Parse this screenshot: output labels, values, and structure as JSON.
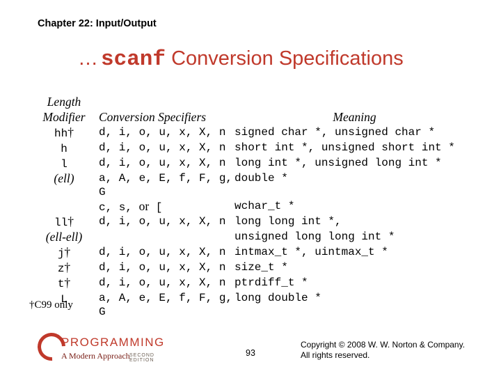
{
  "chapter": "Chapter 22: Input/Output",
  "title": {
    "prefix": "…",
    "code": "scanf",
    "rest": " Conversion Specifications"
  },
  "headers": {
    "mod_l1": "Length",
    "mod_l2": "Modifier",
    "spec": "Conversion Specifiers",
    "mean": "Meaning"
  },
  "rows": [
    {
      "mod_pre": "hh",
      "dag": "†",
      "spec": "d, i, o, u, x, X, n",
      "mean": "signed char *, unsigned char *"
    },
    {
      "mod_pre": "h",
      "spec": "d, i, o, u, x, X, n",
      "mean": "short int *, unsigned short int *"
    },
    {
      "mod_pre": "l",
      "spec": "d, i, o, u, x, X, n",
      "mean": "long int *, unsigned long int *"
    },
    {
      "mod_ell": "(ell)",
      "spec": "a, A, e, E, f, F, g, G",
      "mean": "double *"
    },
    {
      "spec_pre": "c, s, ",
      "spec_or": "or",
      "spec_post": " [",
      "mean": "wchar_t *"
    },
    {
      "mod_pre": "ll",
      "dag": "†",
      "spec": "d, i, o, u, x, X, n",
      "mean": "long long int *,"
    },
    {
      "mod_ell": "(ell-ell)",
      "mean": "unsigned long long int *"
    },
    {
      "mod_pre": "j",
      "dag": "†",
      "spec": "d, i, o, u, x, X, n",
      "mean": "intmax_t *, uintmax_t *"
    },
    {
      "mod_pre": "z",
      "dag": "†",
      "spec": "d, i, o, u, x, X, n",
      "mean": "size_t *"
    },
    {
      "mod_pre": "t",
      "dag": "†",
      "spec": "d, i, o, u, x, X, n",
      "mean": "ptrdiff_t *"
    },
    {
      "mod_pre": "L",
      "spec": "a, A, e, E, f, F, g, G",
      "mean": "long double *"
    }
  ],
  "footnote": {
    "dag": "†",
    "text": "C99 only"
  },
  "logo": {
    "main": "PROGRAMMING",
    "sub": "A Modern Approach",
    "ed": "SECOND EDITION"
  },
  "pagenum": "93",
  "copyright_l1": "Copyright © 2008 W. W. Norton & Company.",
  "copyright_l2": "All rights reserved."
}
